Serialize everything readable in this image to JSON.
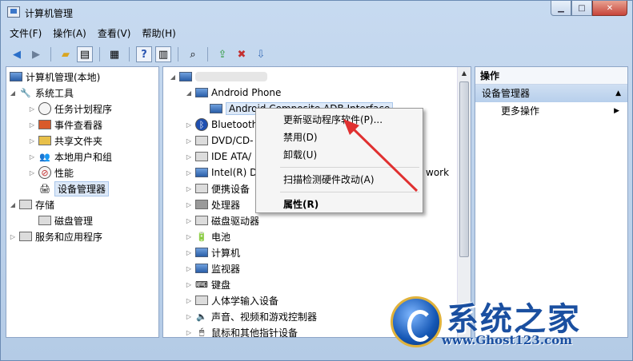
{
  "window": {
    "title": "计算机管理"
  },
  "menu": [
    "文件(F)",
    "操作(A)",
    "查看(V)",
    "帮助(H)"
  ],
  "toolbar": [
    "back-icon",
    "forward-icon",
    "up-folder-icon",
    "show-hide-tree-icon",
    "properties-icon",
    "help-icon",
    "action-pane-icon",
    "scan-hardware-icon",
    "update-driver-icon",
    "disable-device-icon",
    "uninstall-device-icon"
  ],
  "left_tree": {
    "root": "计算机管理(本地)",
    "system_tools": "系统工具",
    "items": [
      "任务计划程序",
      "事件查看器",
      "共享文件夹",
      "本地用户和组",
      "性能",
      "设备管理器"
    ],
    "storage": "存储",
    "disk_mgmt": "磁盘管理",
    "services": "服务和应用程序"
  },
  "device_tree": {
    "android_phone": "Android Phone",
    "android_adb": "Android Composite ADB Interface",
    "categories": [
      "Bluetooth",
      "DVD/CD-",
      "IDE ATA/",
      "Intel(R) D",
      "便携设备",
      "处理器",
      "磁盘驱动器",
      "电池",
      "计算机",
      "监视器",
      "键盘",
      "人体学输入设备",
      "声音、视频和游戏控制器",
      "鼠标和其他指针设备"
    ],
    "network_tail": "work"
  },
  "context_menu": {
    "update_driver": "更新驱动程序软件(P)...",
    "disable": "禁用(D)",
    "uninstall": "卸载(U)",
    "scan": "扫描检测硬件改动(A)",
    "properties": "属性(R)"
  },
  "actions_pane": {
    "header": "操作",
    "section": "设备管理器",
    "more": "更多操作"
  },
  "watermark": {
    "title": "系统之家",
    "url": "www.Ghost123.com"
  },
  "colors": {
    "annotation_arrow": "#e03030",
    "selection": "#dde9f8"
  }
}
